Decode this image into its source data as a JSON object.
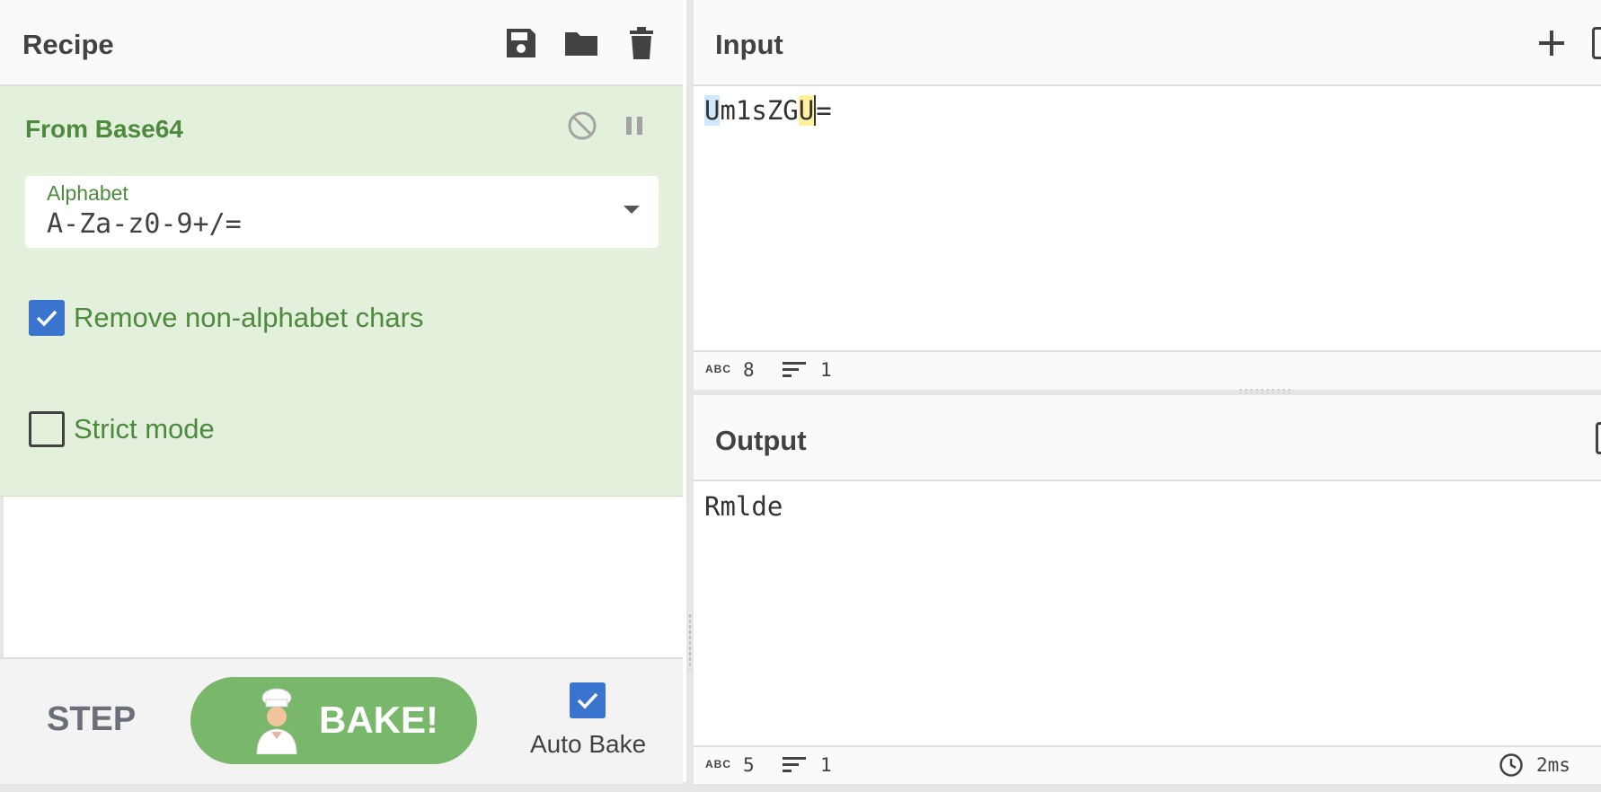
{
  "recipe": {
    "title": "Recipe",
    "icons": [
      "save-icon",
      "folder-icon",
      "trash-icon"
    ]
  },
  "operation": {
    "title": "From Base64",
    "controls": [
      "disable-icon",
      "pause-icon"
    ],
    "alphabet": {
      "label": "Alphabet",
      "value": "A-Za-z0-9+/="
    },
    "remove_non_alphabet": {
      "label": "Remove non-alphabet chars",
      "checked": true
    },
    "strict_mode": {
      "label": "Strict mode",
      "checked": false
    }
  },
  "footer": {
    "step_label": "STEP",
    "bake_label": "BAKE!",
    "auto_bake_label": "Auto Bake",
    "auto_bake_checked": true
  },
  "input": {
    "title": "Input",
    "text_parts": [
      "U",
      "m1sZG",
      "U",
      "="
    ],
    "stats": {
      "abc_label": "ABC",
      "chars": "8",
      "lines": "1"
    }
  },
  "output": {
    "title": "Output",
    "text": "Rmlde",
    "stats": {
      "abc_label": "ABC",
      "chars": "5",
      "lines": "1",
      "time": "2ms"
    }
  },
  "colors": {
    "op_bg": "#e3f0dc",
    "op_text": "#4d8a3e",
    "bake_button": "#79b86a",
    "checkbox_on": "#3a74cf"
  }
}
